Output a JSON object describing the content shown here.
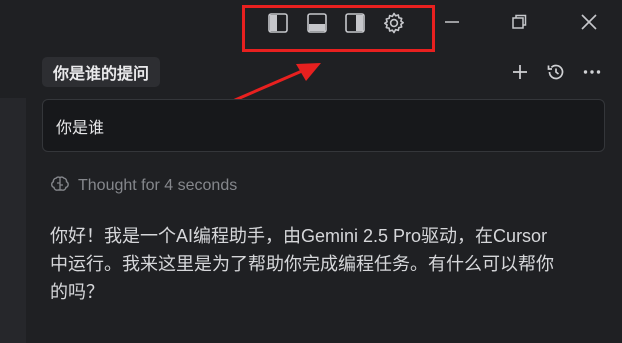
{
  "toolbar": {
    "icons": [
      "toggle-primary-sidebar-icon",
      "toggle-panel-icon",
      "toggle-secondary-sidebar-icon",
      "settings-gear-icon"
    ],
    "window_controls": [
      "minimize-icon",
      "restore-icon",
      "close-icon"
    ]
  },
  "chat": {
    "title": "你是谁的提问",
    "actions": [
      "new-chat-icon",
      "history-icon",
      "more-icon"
    ],
    "user_message": "你是谁",
    "thought_label": "Thought for 4 seconds",
    "answer_lines": [
      "你好！我是一个AI编程助手，由Gemini 2.5 Pro驱动，在Cursor",
      "中运行。我来这里是为了帮助你完成编程任务。有什么可以帮你",
      "的吗？"
    ]
  },
  "colors": {
    "background": "#1f2023",
    "highlight_box": "#e8201f",
    "arrow": "#e8201f",
    "muted_text": "#85878c"
  }
}
